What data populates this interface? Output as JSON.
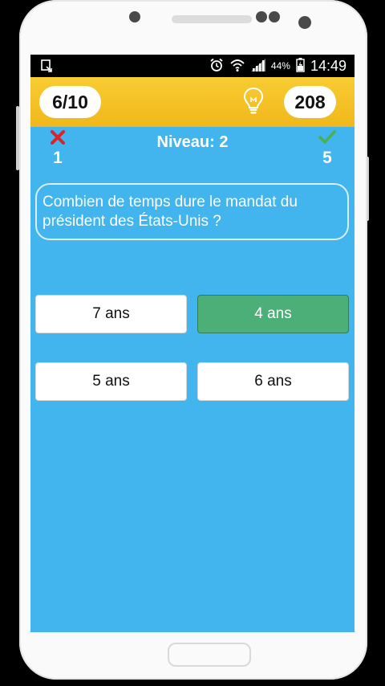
{
  "status_bar": {
    "battery_percent": "44%",
    "time": "14:49"
  },
  "top_bar": {
    "progress": "6/10",
    "score": "208"
  },
  "stats": {
    "wrong_count": "1",
    "level": "Niveau: 2",
    "correct_count": "5"
  },
  "question": {
    "text": "Combien de temps dure le mandat du président des États-Unis ?"
  },
  "answers": [
    {
      "label": "7 ans",
      "state": "default"
    },
    {
      "label": "4 ans",
      "state": "correct"
    },
    {
      "label": "5 ans",
      "state": "default"
    },
    {
      "label": "6 ans",
      "state": "default"
    }
  ],
  "colors": {
    "screen_bg": "#42b4ee",
    "top_bar": "#f5c22a",
    "correct_answer": "#4caf78",
    "wrong_icon": "#d8232a",
    "check_icon": "#4caf50"
  }
}
